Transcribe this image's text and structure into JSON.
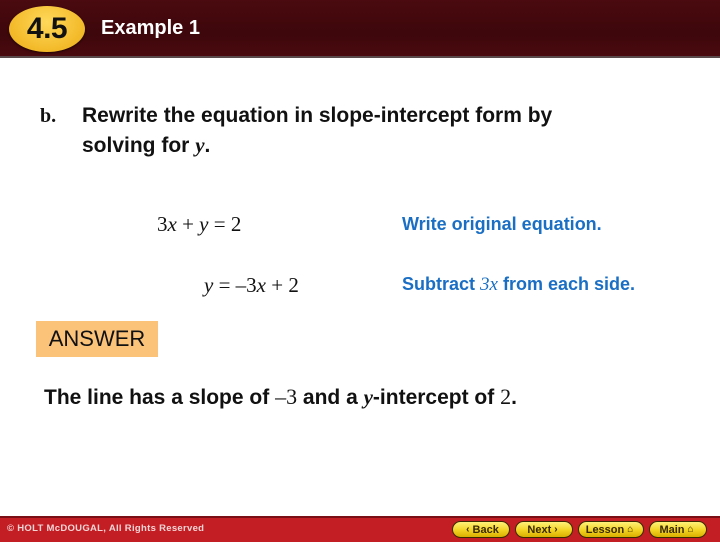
{
  "header": {
    "section_badge": "4.5",
    "title": "Example 1",
    "colors": {
      "bar": "#3d070b",
      "badge": "#f2b928"
    }
  },
  "prompt": {
    "label": "b.",
    "line1": "Rewrite the equation in slope-intercept form by",
    "line2_text": "solving for ",
    "line2_var": "y",
    "line2_end": "."
  },
  "steps": [
    {
      "equation": "3x + y = 2",
      "note_pre": "Write original equation.",
      "note_var": "",
      "note_post": ""
    },
    {
      "equation": "y = –3x + 2",
      "note_pre": "Subtract ",
      "note_var": "3x",
      "note_post": " from each side."
    }
  ],
  "answer": {
    "label": "ANSWER",
    "text_1": "The line has a slope of ",
    "slope": "–3",
    "text_2": " and a ",
    "var": "y",
    "text_3": "-intercept of ",
    "intercept": "2",
    "text_4": ".",
    "color": "#fbc27a"
  },
  "footer": {
    "copyright": "© HOLT McDOUGAL, All Rights Reserved",
    "buttons": [
      {
        "label": "Back",
        "icon": "chevron-left-icon",
        "glyph": "‹"
      },
      {
        "label": "Next",
        "icon": "chevron-right-icon",
        "glyph": "›"
      },
      {
        "label": "Lesson",
        "icon": "home-icon",
        "glyph": "⌂"
      },
      {
        "label": "Main",
        "icon": "home-icon",
        "glyph": "⌂"
      }
    ],
    "color": "#c41e25"
  }
}
